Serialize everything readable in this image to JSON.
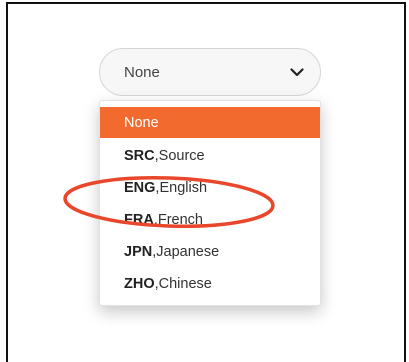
{
  "select": {
    "value": "None",
    "chevron_icon": "chevron-down-icon"
  },
  "dropdown": {
    "options": [
      {
        "label": "None",
        "selected": true
      },
      {
        "code": "SRC",
        "sep": ", ",
        "name": "Source"
      },
      {
        "code": "ENG",
        "sep": ", ",
        "name": "English"
      },
      {
        "code": "FRA",
        "sep": ", ",
        "name": "French"
      },
      {
        "code": "JPN",
        "sep": ", ",
        "name": "Japanese"
      },
      {
        "code": "ZHO",
        "sep": ", ",
        "name": "Chinese"
      }
    ]
  },
  "colors": {
    "accent": "#f26a2e",
    "annotation": "#e8472c"
  }
}
